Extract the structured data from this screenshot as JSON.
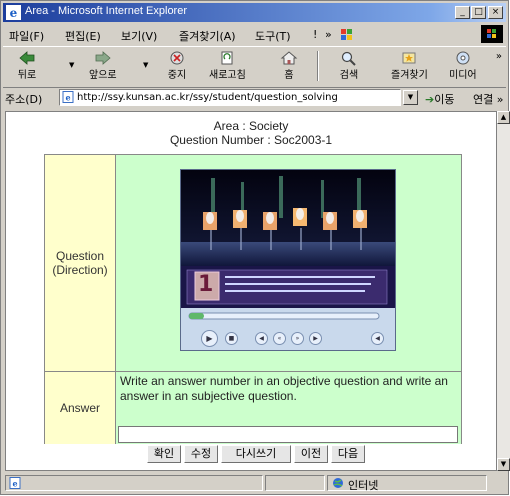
{
  "window": {
    "title": "Area - Microsoft Internet Explorer",
    "controls": {
      "minimize": "_",
      "maximize": "□",
      "close": "×"
    }
  },
  "menu": [
    "파일(F)",
    "편집(E)",
    "보기(V)",
    "즐겨찾기(A)",
    "도구(T)",
    "!",
    "»"
  ],
  "toolbar": {
    "buttons": [
      {
        "label": "뒤로",
        "icon": "back-arrow-icon"
      },
      {
        "label": "앞으로",
        "icon": "forward-arrow-icon"
      },
      {
        "label": "중지",
        "icon": "stop-icon"
      },
      {
        "label": "새로고침",
        "icon": "refresh-icon"
      },
      {
        "label": "홈",
        "icon": "home-icon"
      },
      {
        "label": "검색",
        "icon": "search-icon"
      },
      {
        "label": "즐겨찾기",
        "icon": "favorites-icon"
      },
      {
        "label": "미디어",
        "icon": "media-icon"
      }
    ],
    "overflow": "»"
  },
  "address": {
    "label": "주소(D)",
    "url": "http://ssy.kunsan.ac.kr/ssy/student/question_solving",
    "go": "이동",
    "links": "연결 »"
  },
  "page": {
    "area_line": "Area : Society",
    "question_number_line": "Question Number : Soc2003-1",
    "question_label": "Question (Direction)",
    "answer_label": "Answer",
    "answer_instructions": "Write an answer number in an objective question and write an answer in an subjective question.",
    "answer_value": "",
    "buttons": [
      "확인",
      "수정",
      "다시쓰기",
      "이전",
      "다음"
    ]
  },
  "video": {
    "caption_number": "1",
    "progress": 0.08
  },
  "status": {
    "zone_text": "인터넷"
  },
  "colors": {
    "label_cell": "#ffffcc",
    "content_cell": "#ccffcc",
    "title_bar": "#1c3d9c"
  }
}
